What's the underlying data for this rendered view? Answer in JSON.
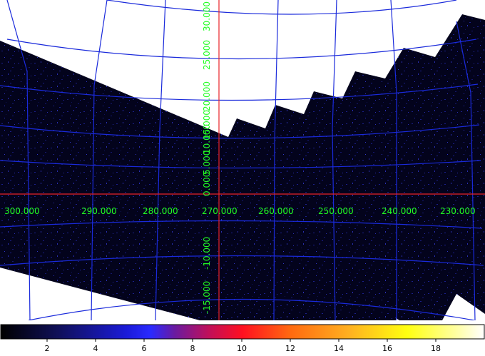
{
  "map": {
    "ra_labels": [
      "300.000",
      "290.000",
      "280.000",
      "270.000",
      "260.000",
      "250.000",
      "240.000",
      "230.000"
    ],
    "dec_labels": [
      "30.000",
      "25.000",
      "20.000",
      "15.000",
      "10.000",
      "5.000",
      "0.000",
      "-10.000",
      "-15.000"
    ],
    "colors": {
      "background": "#ffffff",
      "exposure": "#03031c",
      "grid": "#1a2adb",
      "axis_line": "#e8232a",
      "label": "#22ff22"
    }
  },
  "colorbar": {
    "ticks": [
      "2",
      "4",
      "6",
      "8",
      "10",
      "12",
      "14",
      "16",
      "18"
    ],
    "colormap": "heat (black-blue-purple-red-orange-yellow-white)"
  }
}
